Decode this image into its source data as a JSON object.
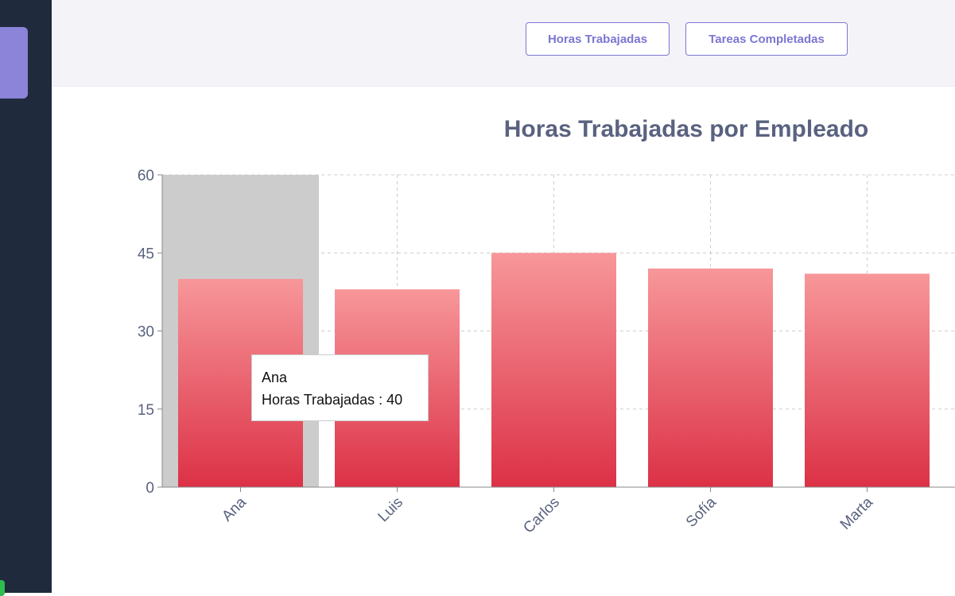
{
  "tabs": {
    "horas_label": "Horas Trabajadas",
    "tareas_label": "Tareas Completadas"
  },
  "chart_data": {
    "type": "bar",
    "title": "Horas Trabajadas por Empleado",
    "categories": [
      "Ana",
      "Luis",
      "Carlos",
      "Sofía",
      "Marta"
    ],
    "series": [
      {
        "name": "Horas Trabajadas",
        "values": [
          40,
          38,
          45,
          42,
          41
        ]
      }
    ],
    "ylim": [
      0,
      60
    ],
    "yticks": [
      0,
      15,
      30,
      45,
      60
    ],
    "grid": true,
    "colors": {
      "bar_top": "#f7979a",
      "bar_bottom": "#dc3146",
      "highlight": "#cccccc",
      "axis_text": "#5a6280"
    }
  },
  "tooltip": {
    "category": "Ana",
    "text": "Horas Trabajadas : 40"
  }
}
